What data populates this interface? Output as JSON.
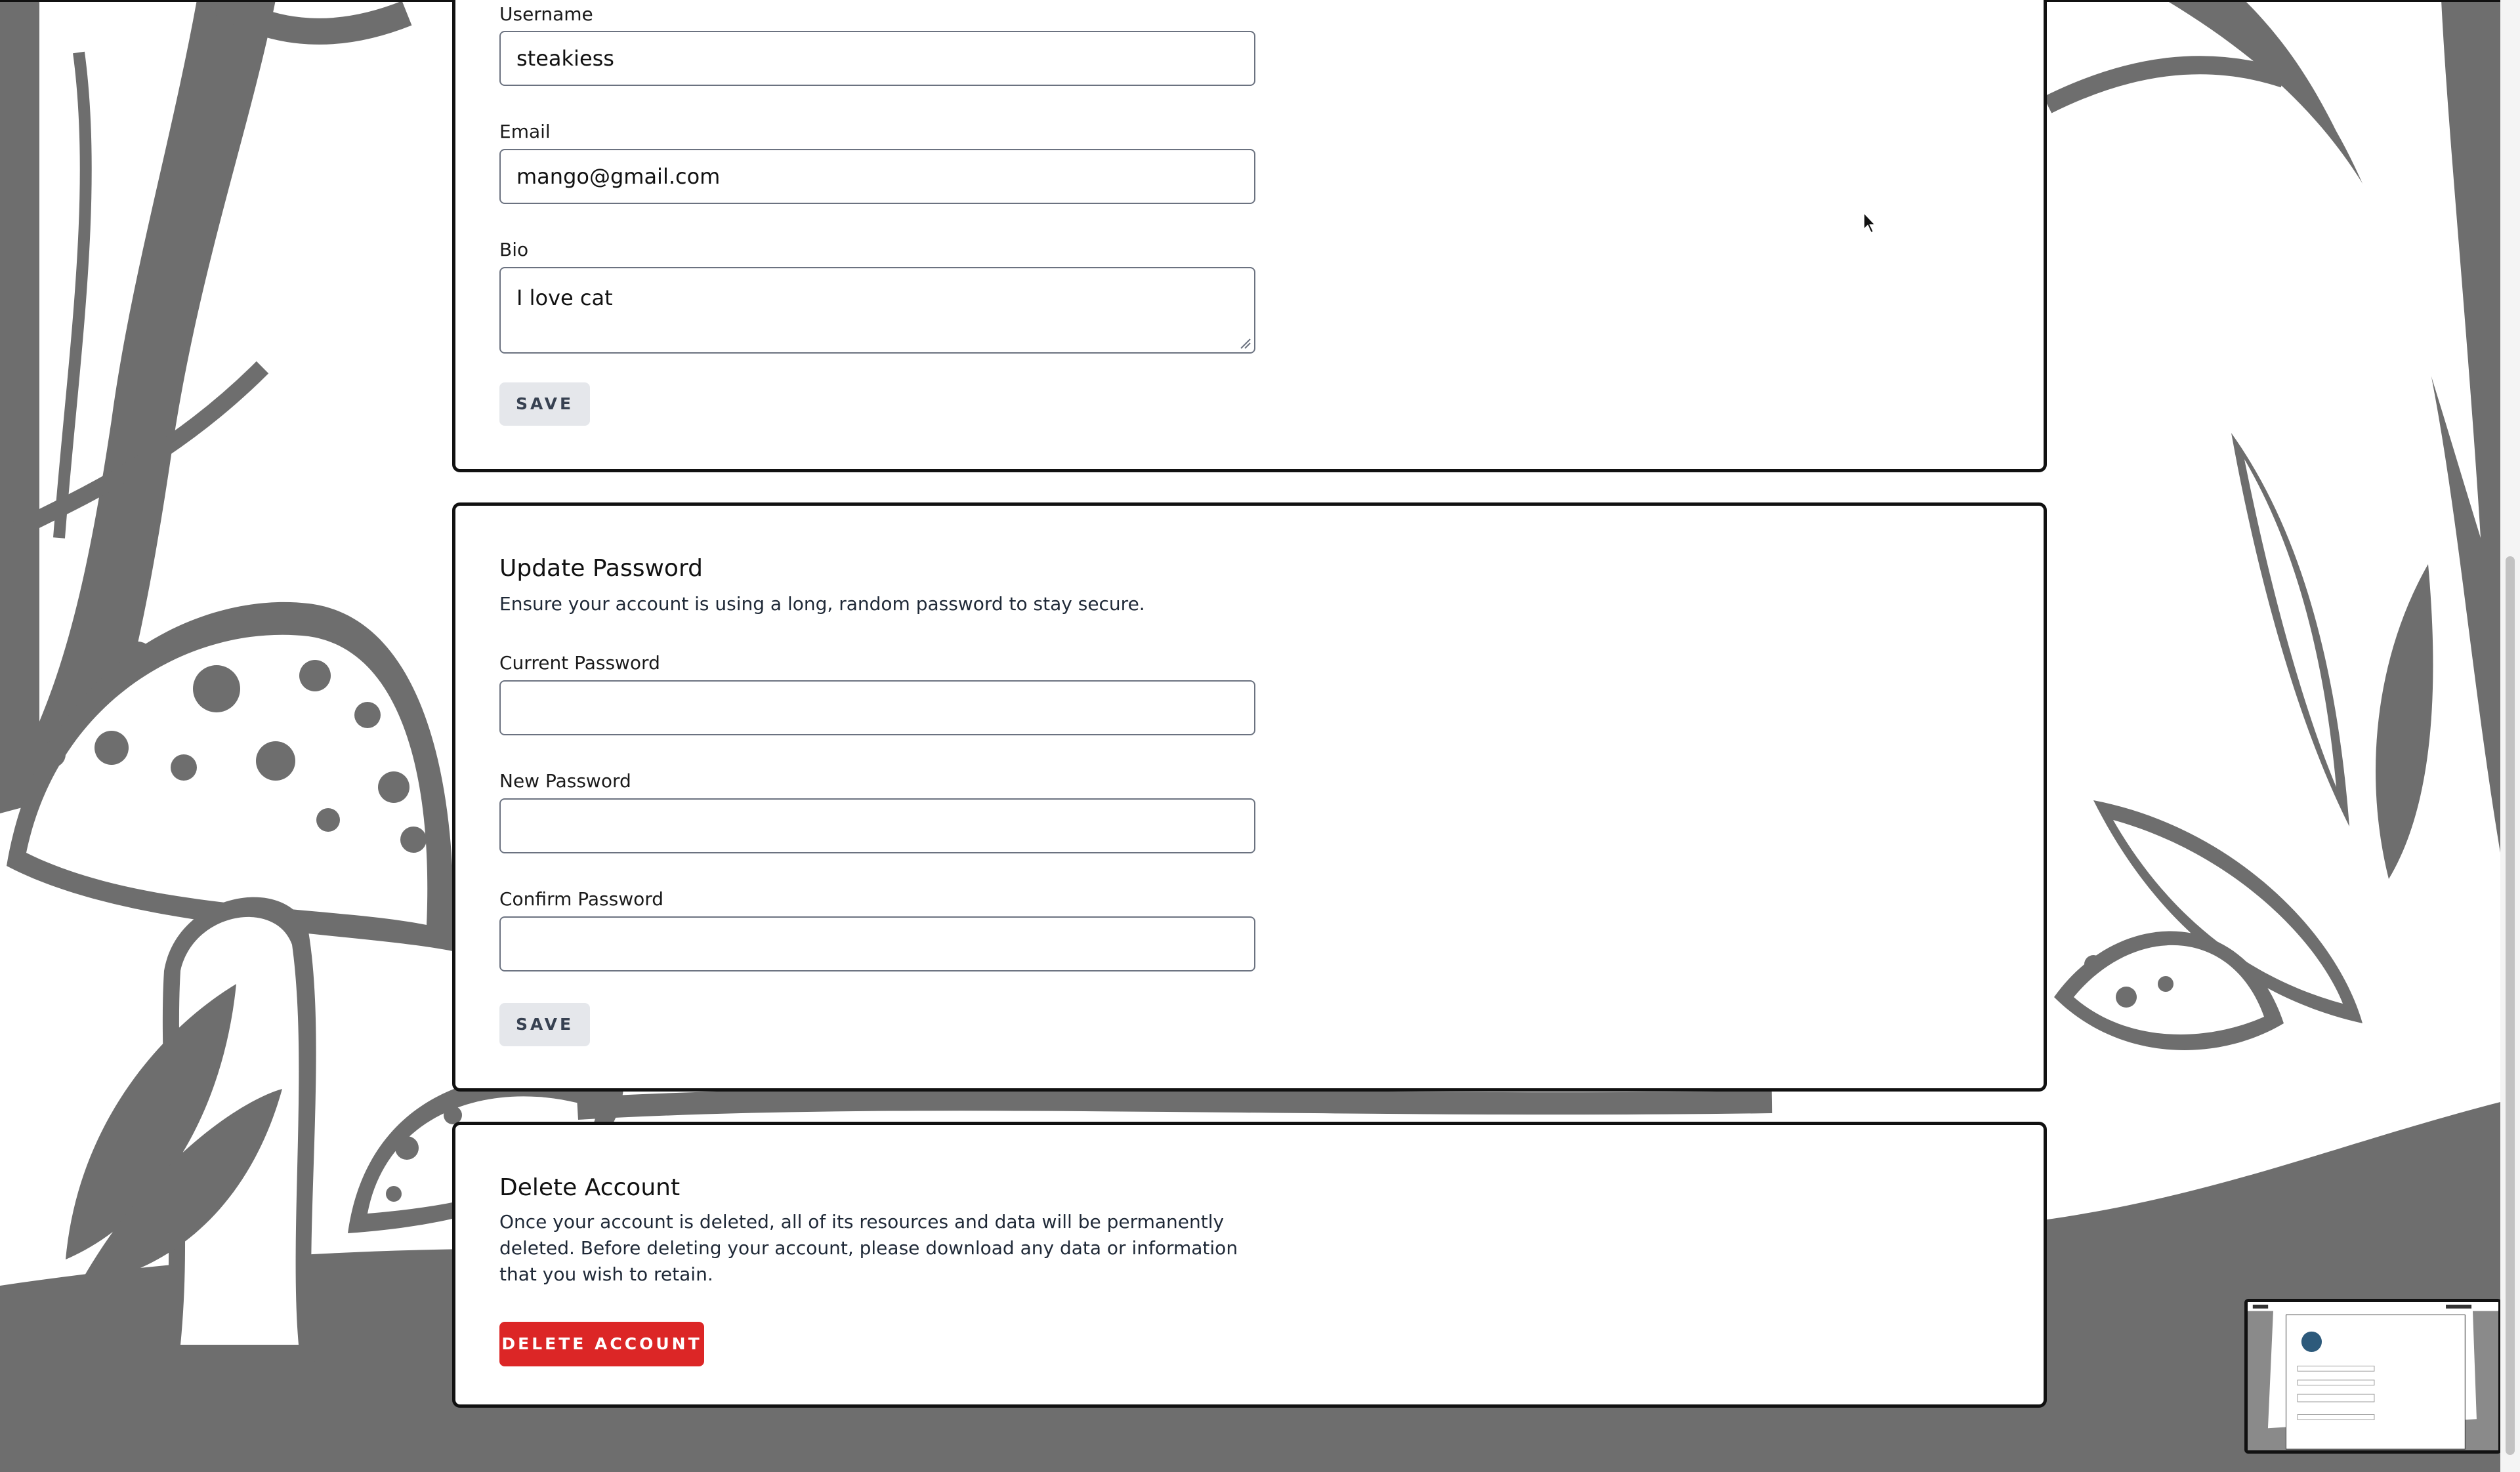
{
  "profile": {
    "username_label": "Username",
    "username_value": "steakiess",
    "email_label": "Email",
    "email_value": "mango@gmail.com",
    "bio_label": "Bio",
    "bio_value": "I love cat",
    "save_label": "SAVE"
  },
  "password": {
    "title": "Update Password",
    "description": "Ensure your account is using a long, random password to stay secure.",
    "current_label": "Current Password",
    "current_value": "",
    "new_label": "New Password",
    "new_value": "",
    "confirm_label": "Confirm Password",
    "confirm_value": "",
    "save_label": "SAVE"
  },
  "delete_account": {
    "title": "Delete Account",
    "description": "Once your account is deleted, all of its resources and data will be permanently deleted. Before deleting your account, please download any data or information that you wish to retain.",
    "button_label": "DELETE ACCOUNT",
    "button_color": "#dc2626"
  },
  "theme": {
    "illustration_color": "#6e6e6e",
    "card_border": "#111111"
  },
  "icons": {
    "cursor": "mouse-pointer-icon",
    "resize": "resize-grip-icon"
  }
}
